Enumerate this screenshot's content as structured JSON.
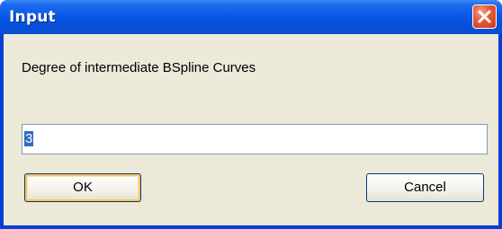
{
  "window": {
    "title": "Input",
    "close_icon": "close-icon"
  },
  "dialog": {
    "prompt": "Degree of intermediate BSpline Curves",
    "input_value": "3",
    "ok_label": "OK",
    "cancel_label": "Cancel"
  },
  "colors": {
    "titlebar": "#0a58e6",
    "client_background": "#ece9d8",
    "close_button": "#e65a38",
    "selection": "#316ac5",
    "default_button_focus": "#f5c46a"
  }
}
